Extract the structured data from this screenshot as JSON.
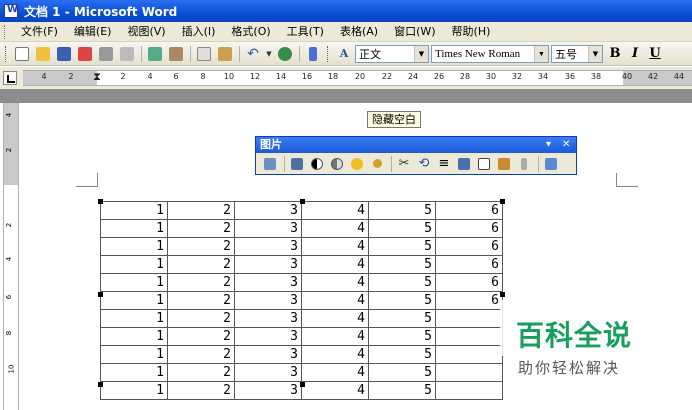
{
  "window": {
    "title": "文档 1 - Microsoft Word"
  },
  "menu": [
    {
      "label": "文件(F)"
    },
    {
      "label": "编辑(E)"
    },
    {
      "label": "视图(V)"
    },
    {
      "label": "插入(I)"
    },
    {
      "label": "格式(O)"
    },
    {
      "label": "工具(T)"
    },
    {
      "label": "表格(A)"
    },
    {
      "label": "窗口(W)"
    },
    {
      "label": "帮助(H)"
    }
  ],
  "toolbar": {
    "style": "正文",
    "font": "Times New Roman",
    "size": "五号",
    "bold": "B",
    "italic": "I",
    "underline": "U"
  },
  "ruler": {
    "labels": [
      "4",
      "2",
      "2",
      "4",
      "6",
      "8",
      "10",
      "12",
      "14",
      "16",
      "18",
      "20",
      "22",
      "24",
      "26",
      "28",
      "30",
      "32",
      "34",
      "36",
      "38",
      "40",
      "42",
      "44"
    ]
  },
  "vruler": {
    "labels": [
      "4",
      "2",
      "2",
      "4",
      "6",
      "8",
      "10"
    ]
  },
  "tooltip": {
    "hide_white": "隐藏空白"
  },
  "picture_toolbar": {
    "title": "图片",
    "close": "✕",
    "menu": "▾"
  },
  "table": {
    "rows": [
      [
        "1",
        "2",
        "3",
        "4",
        "5",
        "6"
      ],
      [
        "1",
        "2",
        "3",
        "4",
        "5",
        "6"
      ],
      [
        "1",
        "2",
        "3",
        "4",
        "5",
        "6"
      ],
      [
        "1",
        "2",
        "3",
        "4",
        "5",
        "6"
      ],
      [
        "1",
        "2",
        "3",
        "4",
        "5",
        "6"
      ],
      [
        "1",
        "2",
        "3",
        "4",
        "5",
        "6"
      ],
      [
        "1",
        "2",
        "3",
        "4",
        "5",
        ""
      ],
      [
        "1",
        "2",
        "3",
        "4",
        "5",
        ""
      ],
      [
        "1",
        "2",
        "3",
        "4",
        "5",
        ""
      ],
      [
        "1",
        "2",
        "3",
        "4",
        "5",
        ""
      ],
      [
        "1",
        "2",
        "3",
        "4",
        "5",
        ""
      ]
    ]
  },
  "watermark": {
    "title": "百科全说",
    "subtitle": "助你轻松解决"
  },
  "colors": {
    "title_bar": "#0a4fd4",
    "watermark_green": "#17a05d"
  }
}
